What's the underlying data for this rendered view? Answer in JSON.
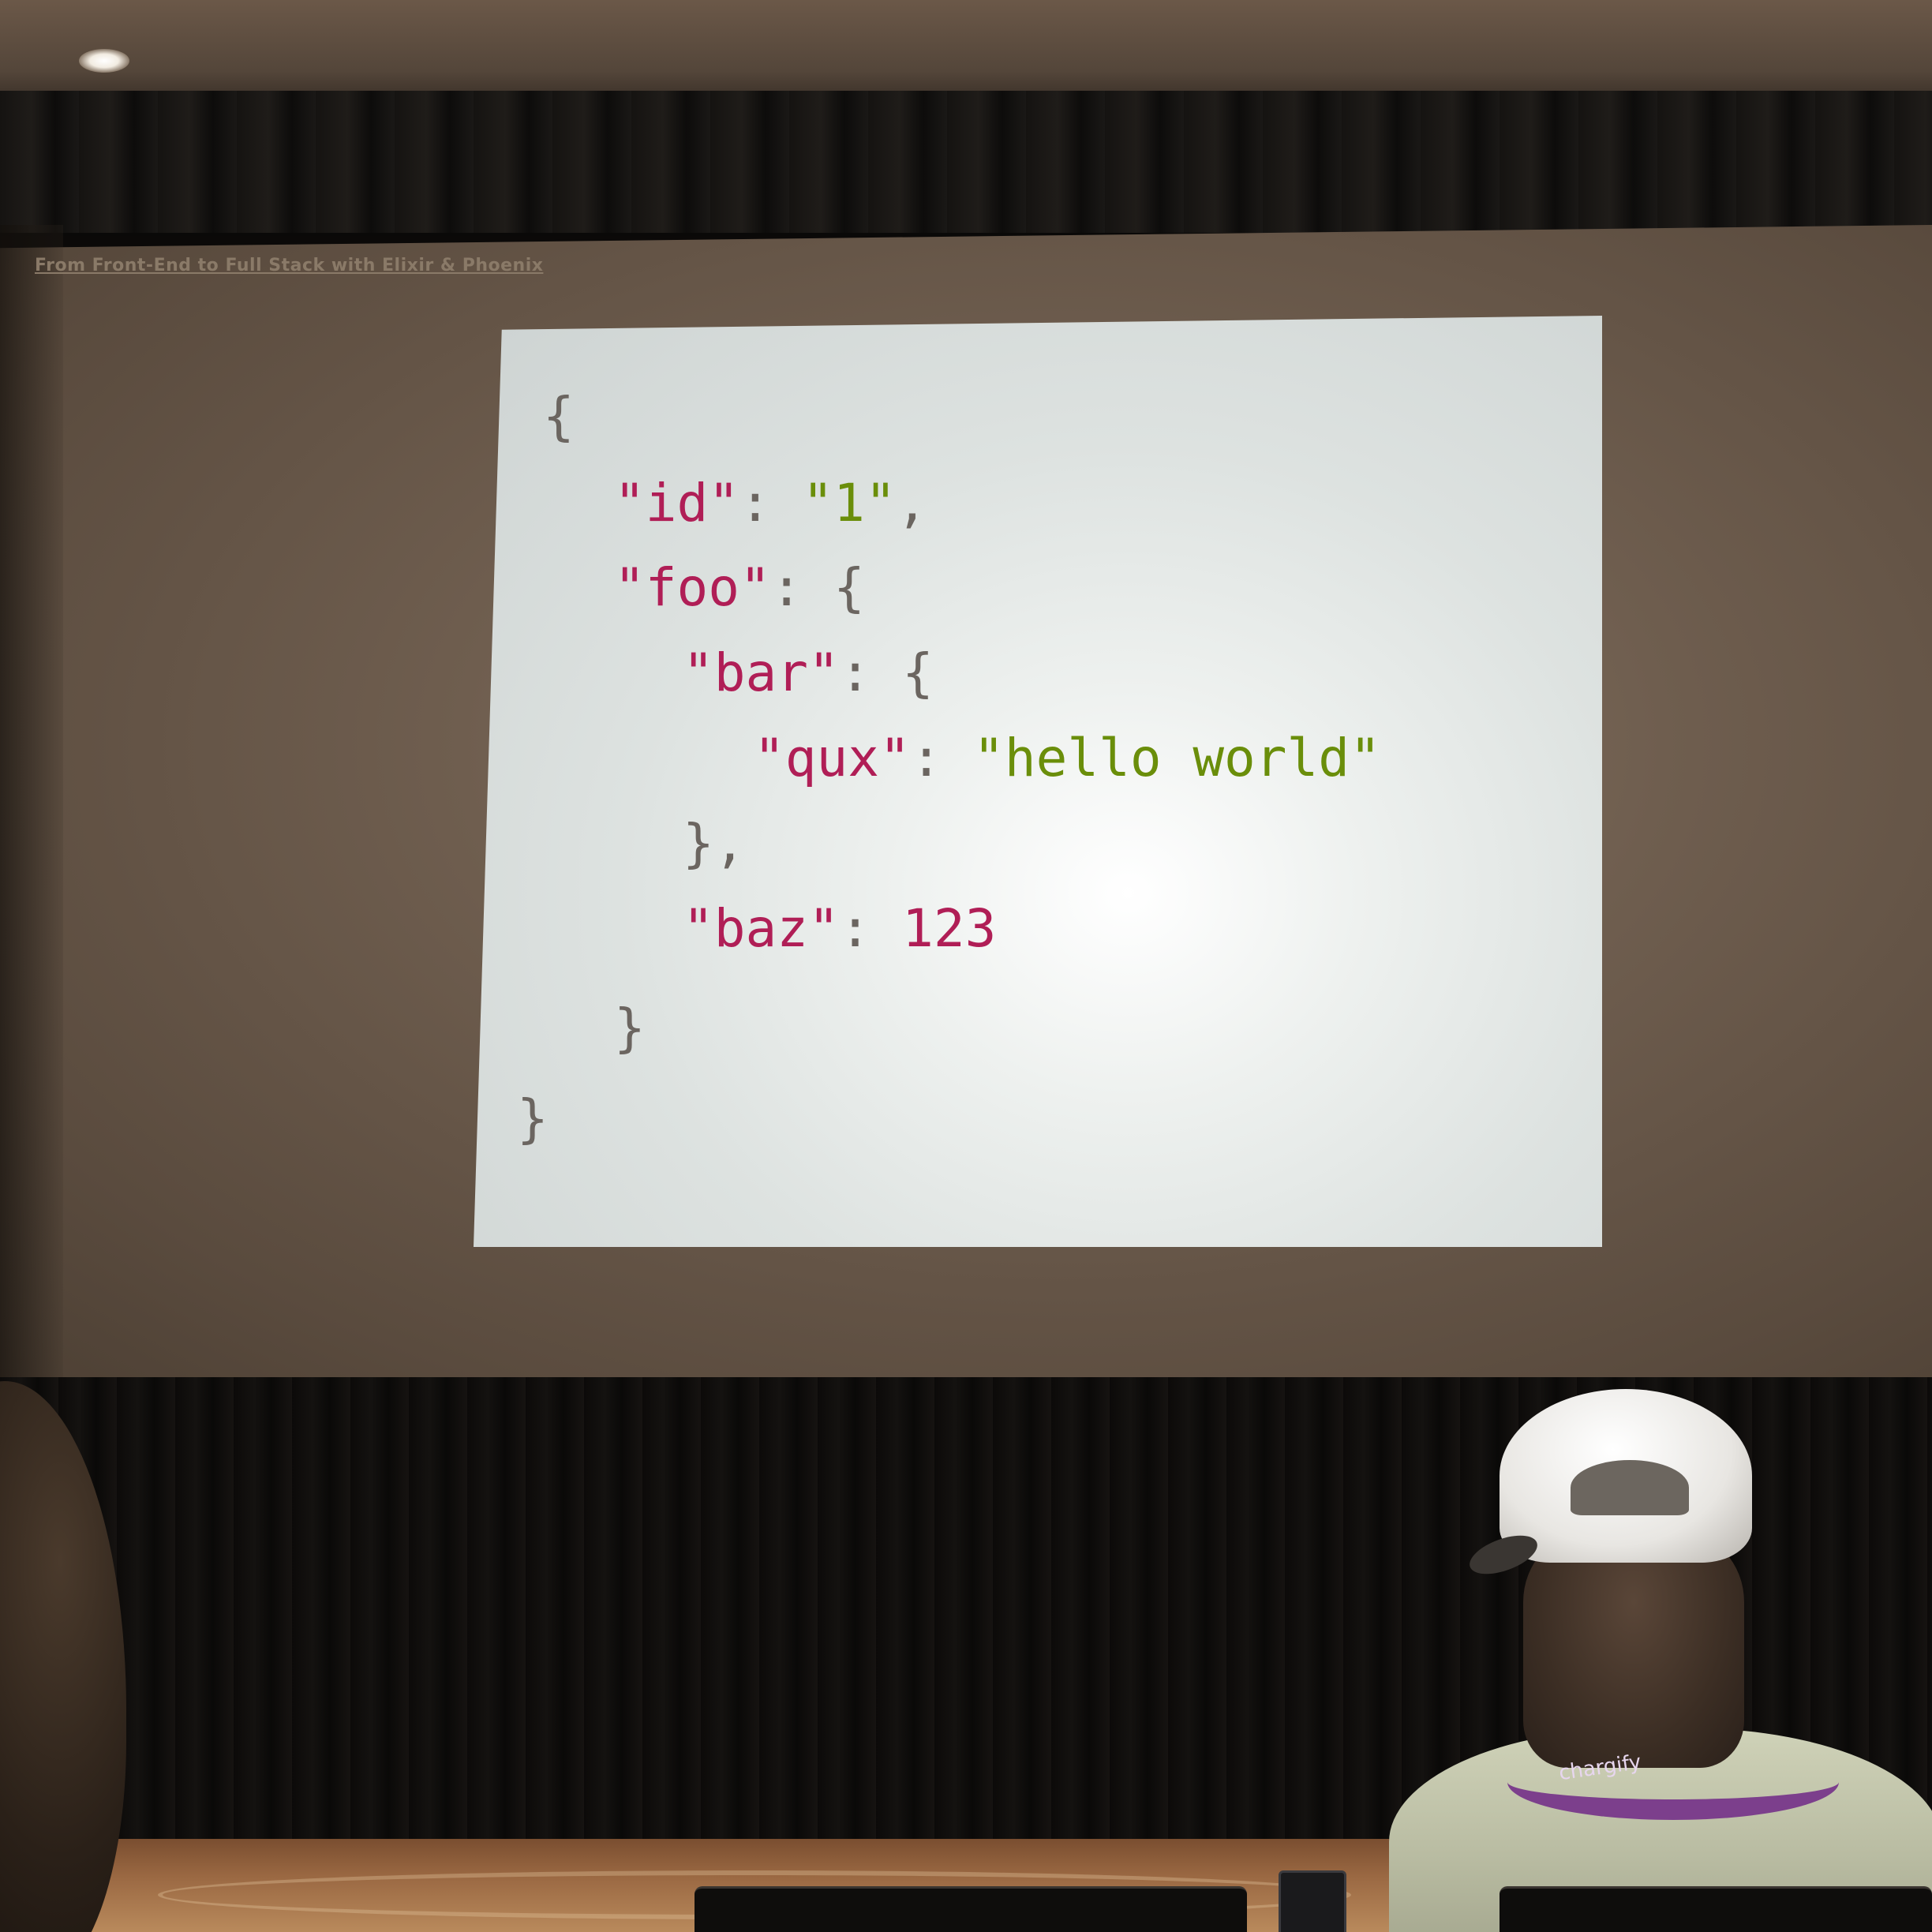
{
  "deck_title": "From Front-End to Full Stack with Elixir & Phoenix",
  "slide": {
    "code_lines": [
      [
        {
          "t": "{",
          "c": "p"
        }
      ],
      [
        {
          "t": "\"id\"",
          "c": "k"
        },
        {
          "t": ": ",
          "c": "p"
        },
        {
          "t": "\"1\"",
          "c": "s"
        },
        {
          "t": ",",
          "c": "p"
        }
      ],
      [
        {
          "t": "\"foo\"",
          "c": "k"
        },
        {
          "t": ": {",
          "c": "p"
        }
      ],
      [
        {
          "t": "\"bar\"",
          "c": "k"
        },
        {
          "t": ": {",
          "c": "p"
        }
      ],
      [
        {
          "t": "\"qux\"",
          "c": "k"
        },
        {
          "t": ": ",
          "c": "p"
        },
        {
          "t": "\"hello world\"",
          "c": "s"
        }
      ],
      [
        {
          "t": "},",
          "c": "p"
        }
      ],
      [
        {
          "t": "\"baz\"",
          "c": "k"
        },
        {
          "t": ": ",
          "c": "p"
        },
        {
          "t": "123",
          "c": "n"
        }
      ],
      [
        {
          "t": "}",
          "c": "p"
        }
      ],
      [
        {
          "t": "}",
          "c": "p"
        }
      ]
    ],
    "colors": {
      "key": "#b01e56",
      "string": "#6a8e0a",
      "number": "#b01e56",
      "punctuation": "#6b6560"
    }
  },
  "lanyard_text": "chargify"
}
